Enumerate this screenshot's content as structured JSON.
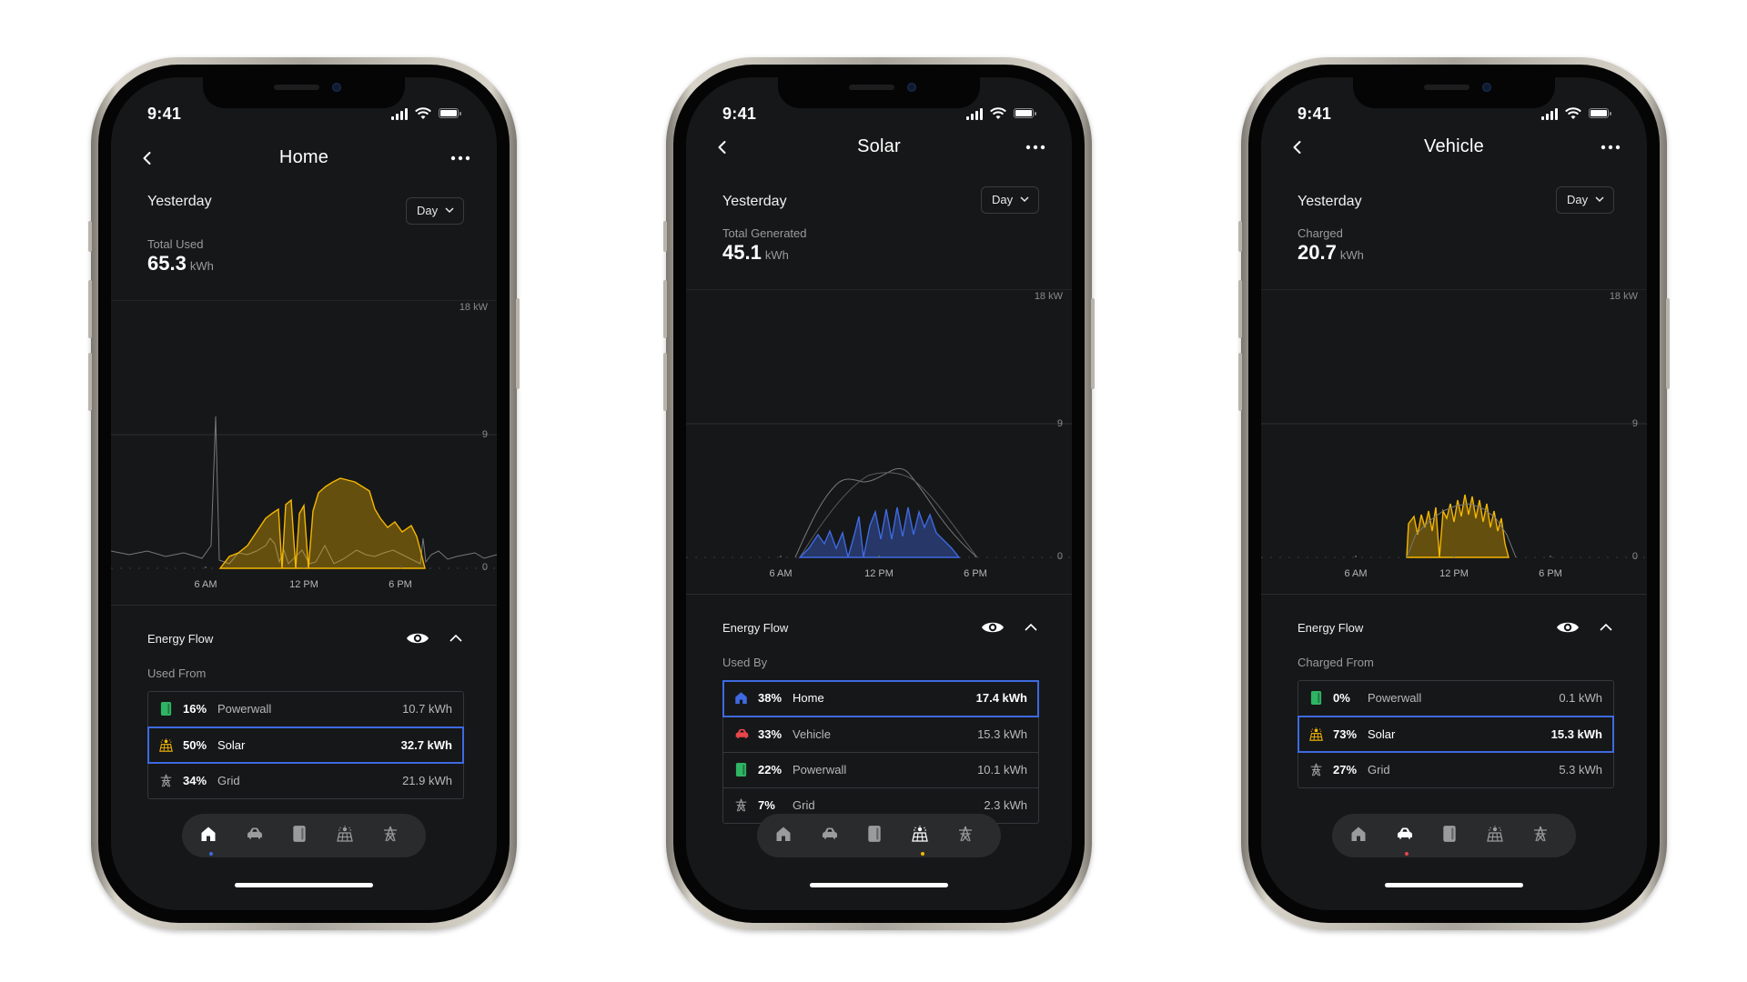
{
  "status_time": "9:41",
  "colors": {
    "home_blue": "#3e6ae1",
    "solar_yellow": "#f5b700",
    "powerwall_green": "#2fb464",
    "vehicle_red": "#e8464a",
    "grid_gray": "#9a9b9d"
  },
  "phones": [
    {
      "title": "Home",
      "period": "Yesterday",
      "range_label": "Day",
      "metric_label": "Total Used",
      "metric_value": "65.3",
      "metric_unit": "kWh",
      "y_labels": [
        "18 kW",
        "9",
        "0"
      ],
      "x_labels": [
        "6 AM",
        "12 PM",
        "6 PM"
      ],
      "flow_title": "Energy Flow",
      "list_title": "Used From",
      "rows": [
        {
          "icon": "powerwall-icon",
          "pct": "16%",
          "name": "Powerwall",
          "value": "10.7 kWh",
          "selected": false
        },
        {
          "icon": "solar-icon",
          "pct": "50%",
          "name": "Solar",
          "value": "32.7 kWh",
          "selected": true
        },
        {
          "icon": "grid-icon",
          "pct": "34%",
          "name": "Grid",
          "value": "21.9 kWh",
          "selected": false
        }
      ],
      "active_tab": 0
    },
    {
      "title": "Solar",
      "period": "Yesterday",
      "range_label": "Day",
      "metric_label": "Total Generated",
      "metric_value": "45.1",
      "metric_unit": "kWh",
      "y_labels": [
        "18 kW",
        "9",
        "0"
      ],
      "x_labels": [
        "6 AM",
        "12 PM",
        "6 PM"
      ],
      "flow_title": "Energy Flow",
      "list_title": "Used By",
      "rows": [
        {
          "icon": "home-icon",
          "pct": "38%",
          "name": "Home",
          "value": "17.4 kWh",
          "selected": true
        },
        {
          "icon": "vehicle-icon",
          "pct": "33%",
          "name": "Vehicle",
          "value": "15.3 kWh",
          "selected": false
        },
        {
          "icon": "powerwall-icon",
          "pct": "22%",
          "name": "Powerwall",
          "value": "10.1 kWh",
          "selected": false
        },
        {
          "icon": "grid-icon",
          "pct": "7%",
          "name": "Grid",
          "value": "2.3 kWh",
          "selected": false
        }
      ],
      "active_tab": 3
    },
    {
      "title": "Vehicle",
      "period": "Yesterday",
      "range_label": "Day",
      "metric_label": "Charged",
      "metric_value": "20.7",
      "metric_unit": "kWh",
      "y_labels": [
        "18 kW",
        "9",
        "0"
      ],
      "x_labels": [
        "6 AM",
        "12 PM",
        "6 PM"
      ],
      "flow_title": "Energy Flow",
      "list_title": "Charged From",
      "rows": [
        {
          "icon": "powerwall-icon",
          "pct": "0%",
          "name": "Powerwall",
          "value": "0.1 kWh",
          "selected": false
        },
        {
          "icon": "solar-icon",
          "pct": "73%",
          "name": "Solar",
          "value": "15.3 kWh",
          "selected": true
        },
        {
          "icon": "grid-icon",
          "pct": "27%",
          "name": "Grid",
          "value": "5.3 kWh",
          "selected": false
        }
      ],
      "active_tab": 1
    }
  ],
  "tabs": [
    "home-icon",
    "vehicle-icon",
    "powerwall-icon",
    "solar-icon",
    "grid-icon"
  ]
}
